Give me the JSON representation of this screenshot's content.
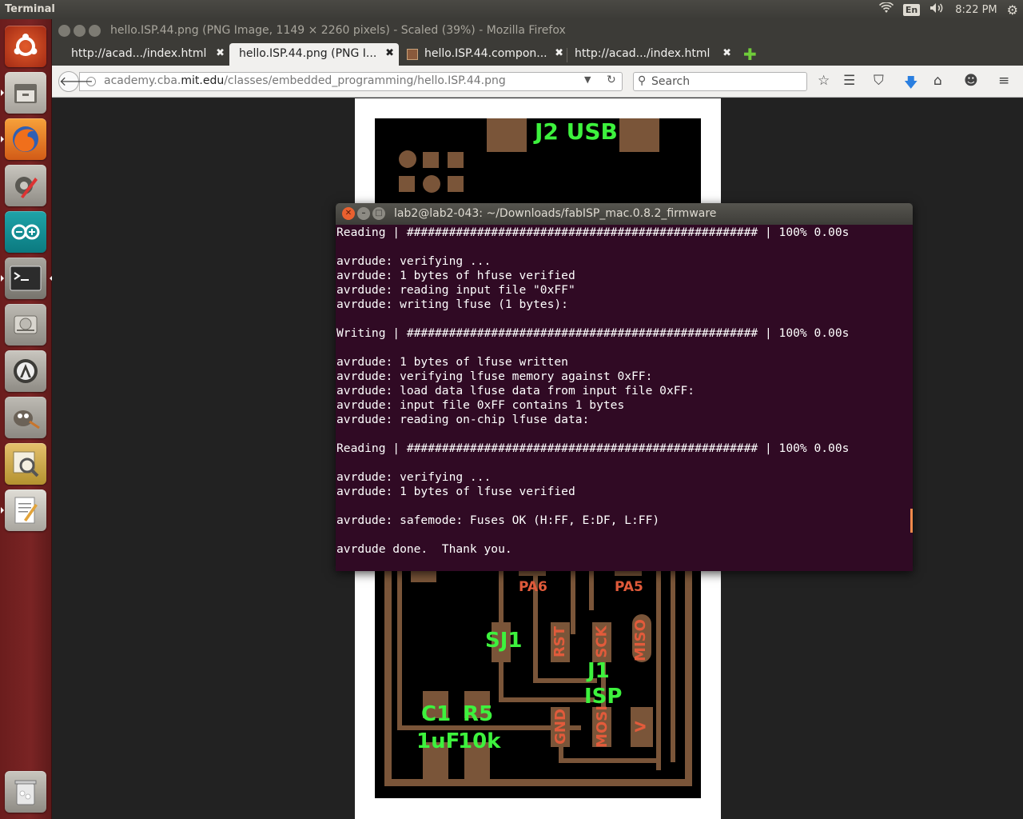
{
  "top_panel": {
    "app_name": "Terminal",
    "lang": "En",
    "clock": "8:22 PM"
  },
  "launcher": {
    "items": [
      "ubuntu-dash",
      "files",
      "firefox",
      "system-settings",
      "arduino",
      "terminal",
      "disk",
      "software-updater",
      "gimp",
      "image-viewer",
      "text-editor",
      "trash"
    ]
  },
  "firefox": {
    "window_title": "hello.ISP.44.png (PNG Image, 1149 × 2260 pixels) - Scaled (39%) - Mozilla Firefox",
    "tabs": [
      {
        "label": "http://acad.../index.html"
      },
      {
        "label": "hello.ISP.44.png (PNG I..."
      },
      {
        "label": "hello.ISP.44.compon..."
      },
      {
        "label": "http://acad.../index.html"
      }
    ],
    "new_tab": "✚",
    "url_host": "academy.cba.",
    "url_host_bold": "mit.edu",
    "url_path": "/classes/embedded_programming/hello.ISP.44.png",
    "search_placeholder": "Search"
  },
  "pcb": {
    "labels_green": {
      "usb": "J2 USB",
      "sj1": "SJ1",
      "j1": "J1",
      "isp": "ISP",
      "c1": "C1",
      "r5": "R5",
      "uf": "1uF",
      "k10": "10k"
    },
    "labels_red": {
      "pa6": "PA6",
      "pa5": "PA5",
      "rst": "RST",
      "sck": "SCK",
      "miso": "MISO",
      "gnd": "GND",
      "mosi": "MOSI",
      "v": "V"
    }
  },
  "terminal": {
    "title": "lab2@lab2-043: ~/Downloads/fabISP_mac.0.8.2_firmware",
    "lines": [
      "Reading | ################################################## | 100% 0.00s",
      "",
      "avrdude: verifying ...",
      "avrdude: 1 bytes of hfuse verified",
      "avrdude: reading input file \"0xFF\"",
      "avrdude: writing lfuse (1 bytes):",
      "",
      "Writing | ################################################## | 100% 0.00s",
      "",
      "avrdude: 1 bytes of lfuse written",
      "avrdude: verifying lfuse memory against 0xFF:",
      "avrdude: load data lfuse data from input file 0xFF:",
      "avrdude: input file 0xFF contains 1 bytes",
      "avrdude: reading on-chip lfuse data:",
      "",
      "Reading | ################################################## | 100% 0.00s",
      "",
      "avrdude: verifying ...",
      "avrdude: 1 bytes of lfuse verified",
      "",
      "avrdude: safemode: Fuses OK (H:FF, E:DF, L:FF)",
      "",
      "avrdude done.  Thank you."
    ]
  }
}
